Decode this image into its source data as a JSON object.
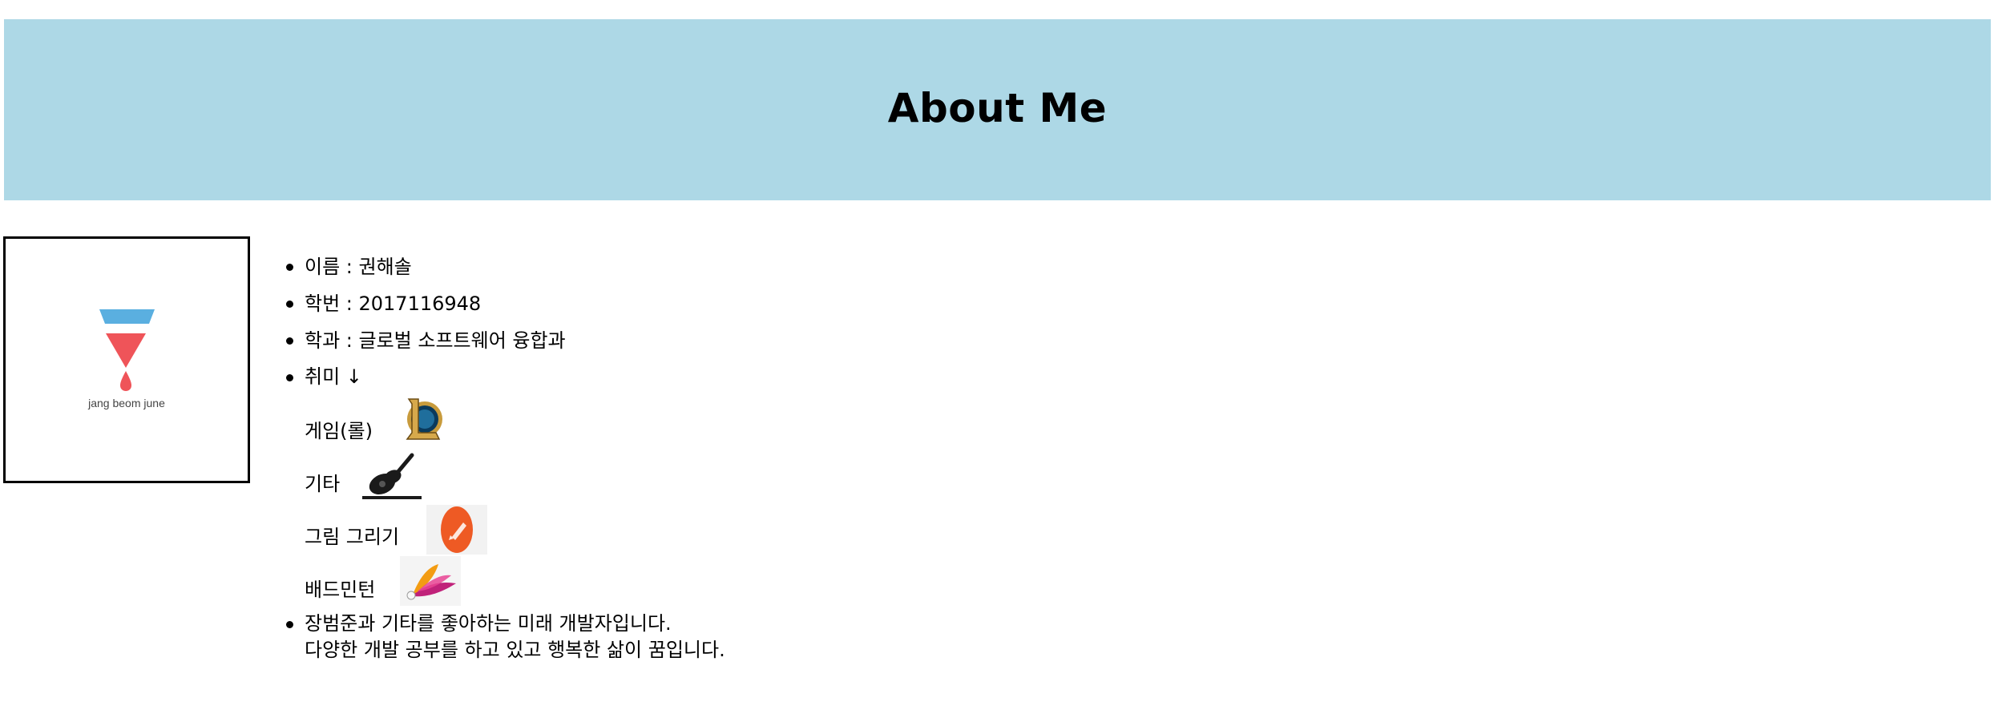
{
  "header": {
    "title": "About Me",
    "background_color": "#add8e6"
  },
  "profile": {
    "logo_caption": "jang beom june",
    "colors": {
      "top_triangle": "#5aafe0",
      "bottom_triangle": "#ef5459",
      "drop": "#ef5459"
    }
  },
  "info": {
    "name": "이름 : 권해솔",
    "student_id": "학번 : 2017116948",
    "department": "학과 : 글로벌 소프트웨어 융합과",
    "hobby_title": "취미 ↓",
    "hobbies": [
      {
        "label": "게임(롤)",
        "icon": "league-of-legends-icon"
      },
      {
        "label": "기타",
        "icon": "guitar-icon"
      },
      {
        "label": "그림 그리기",
        "icon": "drawing-icon"
      },
      {
        "label": "배드민턴",
        "icon": "badminton-icon"
      }
    ],
    "description_line1": "장범준과 기타를 좋아하는 미래 개발자입니다.",
    "description_line2": "다양한 개발 공부를 하고 있고 행복한 삶이 꿈입니다."
  }
}
